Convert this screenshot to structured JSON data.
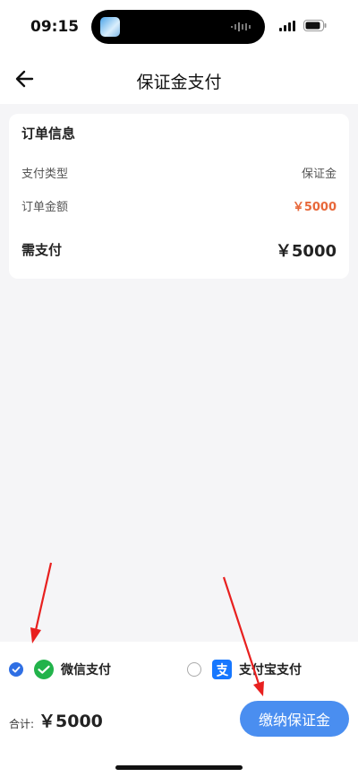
{
  "status_bar": {
    "time": "09:15",
    "icons": [
      "signal-icon",
      "battery-icon"
    ]
  },
  "nav": {
    "title": "保证金支付",
    "back_icon": "arrow-left-icon"
  },
  "order": {
    "title": "订单信息",
    "type_label": "支付类型",
    "type_value": "保证金",
    "amount_label": "订单金额",
    "amount_value": "￥5000",
    "due_label": "需支付",
    "due_value": "￥5000"
  },
  "payment": {
    "wechat_label": "微信支付",
    "wechat_selected": true,
    "alipay_label": "支付宝支付",
    "alipay_selected": false
  },
  "summary": {
    "total_label": "合计:",
    "total_value": "￥5000",
    "pay_button_label": "缴纳保证金"
  },
  "colors": {
    "accent": "#4a8ef0",
    "checked": "#2f6fe4",
    "amount": "#e8683a",
    "wechat": "#22b34b",
    "alipay": "#1677ff",
    "annotation": "#e8201f"
  }
}
